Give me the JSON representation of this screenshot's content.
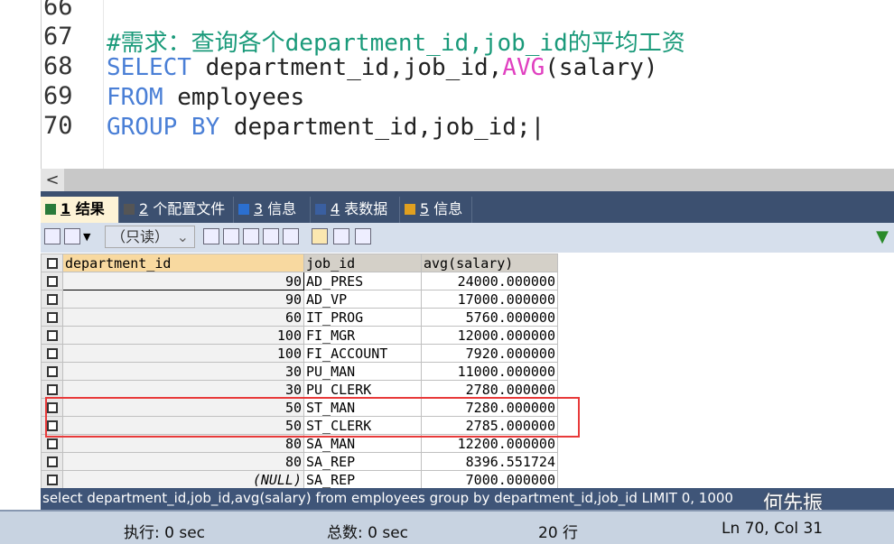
{
  "editor": {
    "lines": [
      {
        "num": "66",
        "parts": []
      },
      {
        "num": "67",
        "parts": [
          {
            "t": "#需求：查询各个department_id,job_id的平均工资",
            "c": "cm"
          }
        ]
      },
      {
        "num": "68",
        "parts": [
          {
            "t": "SELECT",
            "c": "kw"
          },
          {
            "t": " department_id,job_id,",
            "c": ""
          },
          {
            "t": "AVG",
            "c": "fn"
          },
          {
            "t": "(salary)",
            "c": ""
          }
        ]
      },
      {
        "num": "69",
        "parts": [
          {
            "t": "FROM",
            "c": "kw"
          },
          {
            "t": " employees",
            "c": ""
          }
        ]
      },
      {
        "num": "70",
        "parts": [
          {
            "t": "GROUP BY",
            "c": "kw"
          },
          {
            "t": " department_id,job_id;",
            "c": ""
          }
        ]
      }
    ]
  },
  "tabs": [
    {
      "num": "1",
      "label": " 结果"
    },
    {
      "num": "2",
      "label": " 个配置文件"
    },
    {
      "num": "3",
      "label": " 信息"
    },
    {
      "num": "4",
      "label": " 表数据"
    },
    {
      "num": "5",
      "label": " 信息"
    }
  ],
  "toolbar": {
    "readonly": "（只读）"
  },
  "grid": {
    "columns": [
      "department_id",
      "job_id",
      "avg(salary)"
    ],
    "rows": [
      [
        "90",
        "AD_PRES",
        "24000.000000"
      ],
      [
        "90",
        "AD_VP",
        "17000.000000"
      ],
      [
        "60",
        "IT_PROG",
        "5760.000000"
      ],
      [
        "100",
        "FI_MGR",
        "12000.000000"
      ],
      [
        "100",
        "FI_ACCOUNT",
        "7920.000000"
      ],
      [
        "30",
        "PU_MAN",
        "11000.000000"
      ],
      [
        "30",
        "PU_CLERK",
        "2780.000000"
      ],
      [
        "50",
        "ST_MAN",
        "7280.000000"
      ],
      [
        "50",
        "ST_CLERK",
        "2785.000000"
      ],
      [
        "80",
        "SA_MAN",
        "12200.000000"
      ],
      [
        "80",
        "SA_REP",
        "8396.551724"
      ],
      [
        "(NULL)",
        "SA_REP",
        "7000.000000"
      ]
    ]
  },
  "query": "select department_id,job_id,avg(salary) from employees group by department_id,job_id LIMIT 0, 1000",
  "status": {
    "exec": "执行: 0 sec",
    "total": "总数: 0 sec",
    "rows": "20 行",
    "pos": "Ln 70, Col 31"
  },
  "watermark": "何先振",
  "colors": {
    "highlight": "#e83a3a",
    "keyword": "#4a7fd6",
    "function": "#e040c0",
    "comment": "#1a9a7a"
  }
}
